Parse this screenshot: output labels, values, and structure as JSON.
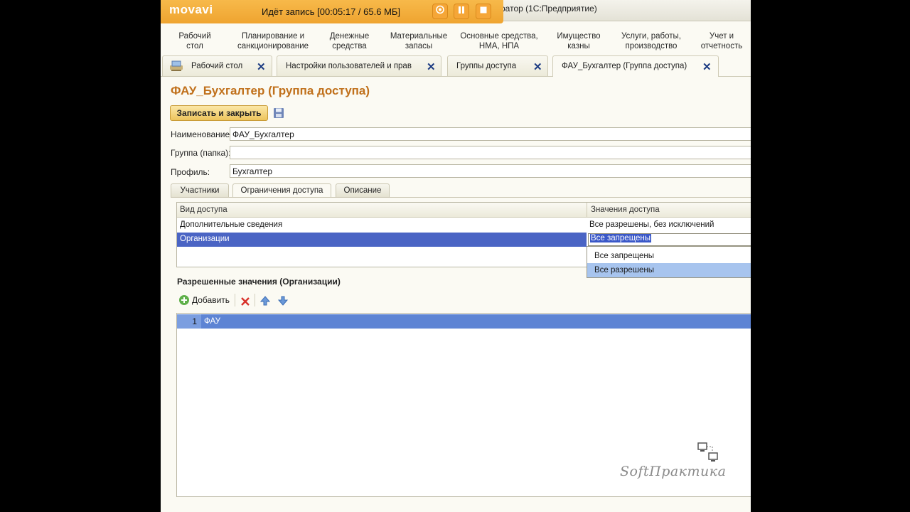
{
  "window": {
    "title_fragment": "ратор  (1С:Предприятие)"
  },
  "recorder": {
    "logo": "movavi",
    "status": "Идёт запись   [00:05:17 / 65.6 МБ]",
    "icons": [
      "camera-icon",
      "pause-icon",
      "stop-icon"
    ]
  },
  "sections": [
    {
      "label": "Рабочий\nстол"
    },
    {
      "label": "Планирование и\nсанкционирование"
    },
    {
      "label": "Денежные\nсредства"
    },
    {
      "label": "Материальные\nзапасы"
    },
    {
      "label": "Основные средства,\nНМА, НПА"
    },
    {
      "label": "Имущество\nказны"
    },
    {
      "label": "Услуги, работы,\nпроизводство"
    },
    {
      "label": "Учет и\nотчетность"
    }
  ],
  "tabs": [
    {
      "label": "Рабочий стол"
    },
    {
      "label": "Настройки пользователей и прав"
    },
    {
      "label": "Группы доступа"
    },
    {
      "label": "ФАУ_Бухгалтер (Группа доступа)"
    }
  ],
  "form": {
    "title": "ФАУ_Бухгалтер (Группа доступа)",
    "save_close_label": "Записать и закрыть",
    "fields": {
      "name_label": "Наименование:",
      "name_value": "ФАУ_Бухгалтер",
      "group_label": "Группа (папка):",
      "group_value": "",
      "profile_label": "Профиль:",
      "profile_value": "Бухгалтер"
    },
    "inner_tabs": [
      "Участники",
      "Ограничения доступа",
      "Описание"
    ]
  },
  "access_table": {
    "columns": [
      "Вид доступа",
      "Значения доступа"
    ],
    "rows": [
      {
        "kind": "Дополнительные сведения",
        "value": "Все разрешены, без исключений"
      },
      {
        "kind": "Организации",
        "value": "Все запрещены"
      }
    ],
    "dropdown_options": [
      "Все запрещены",
      "Все разрешены"
    ]
  },
  "allowed": {
    "title": "Разрешенные значения (Организации)",
    "add_label": "Добавить",
    "rows": [
      {
        "num": "1",
        "value": "ФАУ"
      }
    ]
  },
  "watermark": "SoftПрактика"
}
